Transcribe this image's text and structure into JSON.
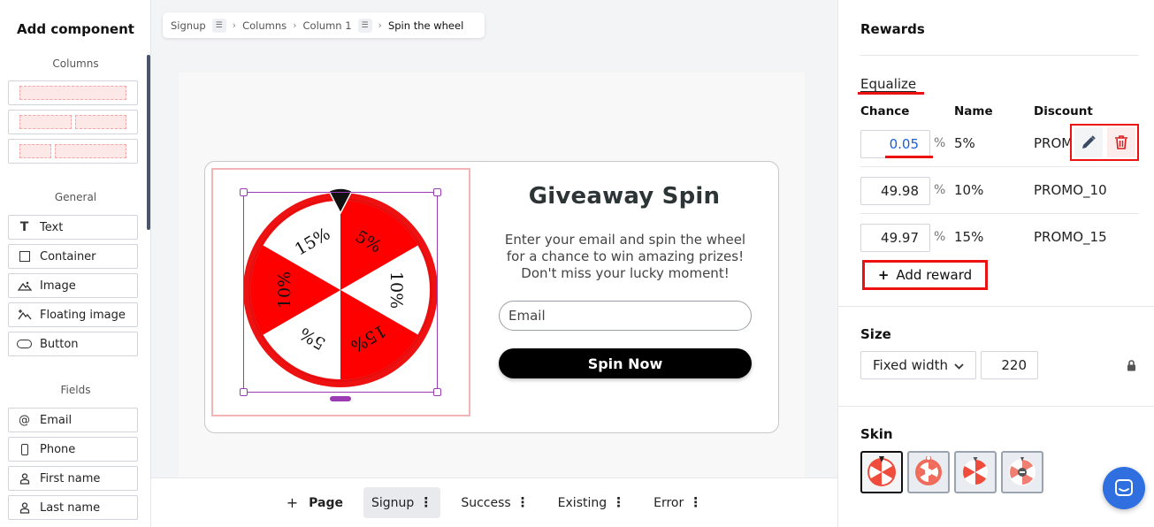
{
  "left": {
    "title": "Add component",
    "sections": {
      "columns": "Columns",
      "general": "General",
      "fields": "Fields"
    },
    "general_items": [
      {
        "label": "Text",
        "icon": "text-icon"
      },
      {
        "label": "Container",
        "icon": "container-icon"
      },
      {
        "label": "Image",
        "icon": "image-icon"
      },
      {
        "label": "Floating image",
        "icon": "floating-image-icon"
      },
      {
        "label": "Button",
        "icon": "button-icon"
      }
    ],
    "field_items": [
      {
        "label": "Email",
        "icon": "at-icon"
      },
      {
        "label": "Phone",
        "icon": "phone-icon"
      },
      {
        "label": "First name",
        "icon": "person-icon"
      },
      {
        "label": "Last name",
        "icon": "person-icon"
      }
    ]
  },
  "breadcrumb": [
    "Signup",
    "Columns",
    "Column 1",
    "Spin the wheel"
  ],
  "popup": {
    "title": "Giveaway Spin",
    "description": "Enter your email and spin the wheel for a chance to win amazing prizes! Don't miss your lucky moment!",
    "email_placeholder": "Email",
    "button": "Spin Now",
    "wheel_segments": [
      "5%",
      "10%",
      "15%",
      "5%",
      "10%",
      "15%"
    ],
    "wheel_colors": {
      "red": "#ff0000",
      "white": "#ffffff",
      "rim": "#ee1111"
    }
  },
  "pages": {
    "add_label": "Page",
    "tabs": [
      "Signup",
      "Success",
      "Existing",
      "Error"
    ],
    "active": "Signup"
  },
  "right": {
    "rewards_title": "Rewards",
    "equalize": "Equalize",
    "headers": {
      "chance": "Chance",
      "name": "Name",
      "discount": "Discount"
    },
    "rewards": [
      {
        "chance": "0.05",
        "name": "5%",
        "discount": "PROMO_5"
      },
      {
        "chance": "49.98",
        "name": "10%",
        "discount": "PROMO_10"
      },
      {
        "chance": "49.97",
        "name": "15%",
        "discount": "PROMO_15"
      }
    ],
    "percent_sign": "%",
    "add_reward": "Add reward",
    "size_title": "Size",
    "size_mode": "Fixed width",
    "size_value": "220",
    "skin_title": "Skin"
  },
  "colors": {
    "accent": "#e11111",
    "selection": "#9c3cb4",
    "chat": "#2f6fe0"
  }
}
